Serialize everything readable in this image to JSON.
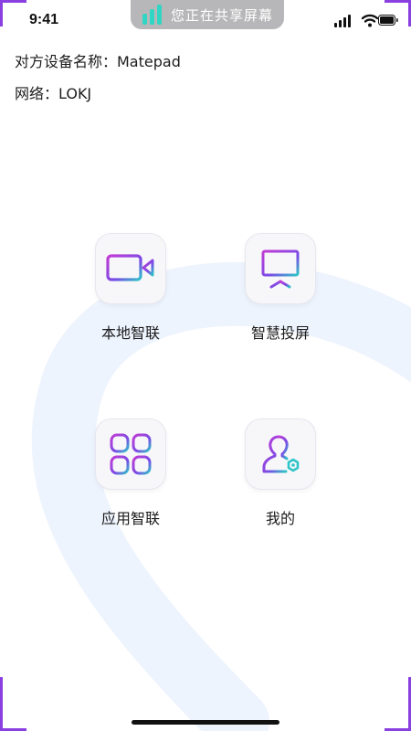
{
  "status_bar": {
    "time": "9:41",
    "screen_share_text": "您正在共享屏幕",
    "icons": [
      "signal-icon",
      "wifi-icon",
      "battery-icon"
    ]
  },
  "info": {
    "device_line": "对方设备名称：Matepad",
    "network_line": "网络：LOKJ"
  },
  "tiles": [
    {
      "id": "local",
      "label": "本地智联",
      "icon": "video-camera-icon"
    },
    {
      "id": "cast",
      "label": "智慧投屏",
      "icon": "projector-screen-icon"
    },
    {
      "id": "apps",
      "label": "应用智联",
      "icon": "apps-grid-icon"
    },
    {
      "id": "mine",
      "label": "我的",
      "icon": "user-settings-icon"
    }
  ],
  "colors": {
    "accent_purple": "#8a3fe0",
    "accent_magenta": "#c23bd4",
    "accent_teal": "#2ec5c8",
    "arc_blue": "#eef4fd",
    "share_pill": "#b7b7b9",
    "share_bars": "#2ed6c3"
  }
}
